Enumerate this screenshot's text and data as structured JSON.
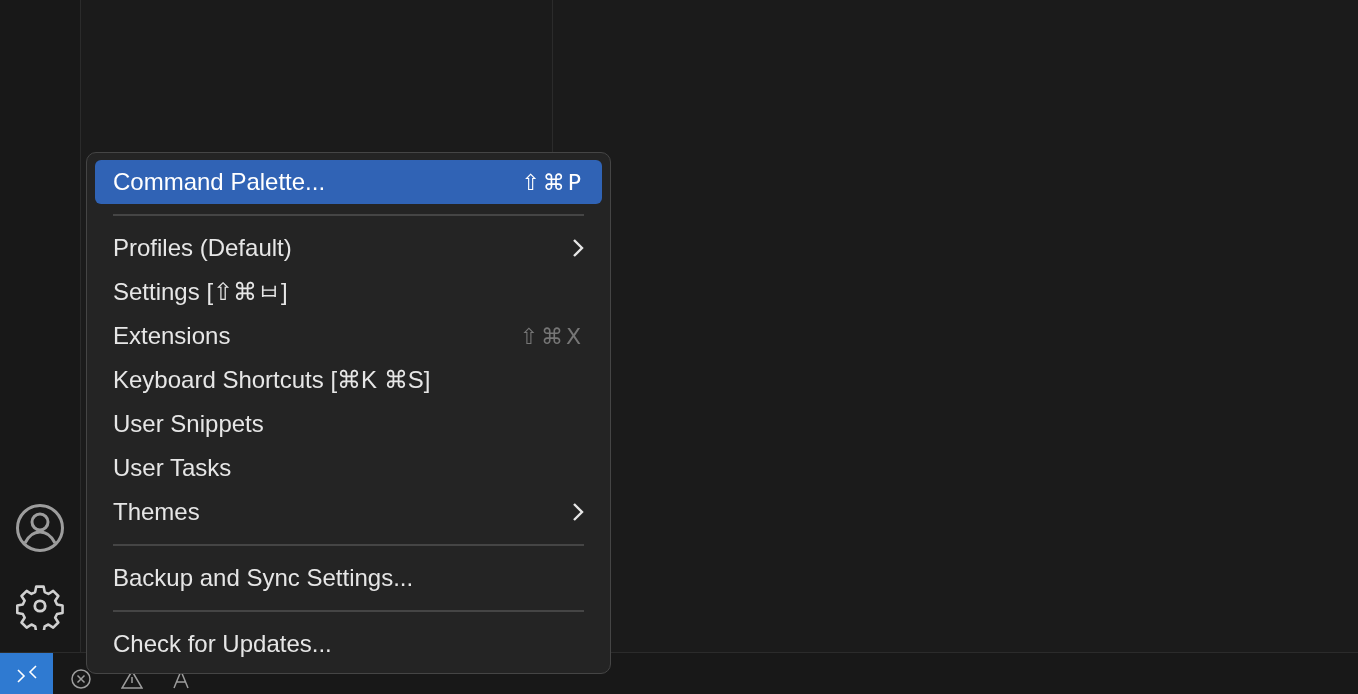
{
  "activity_bar": {
    "items": [
      {
        "kind": "account"
      },
      {
        "kind": "settings"
      }
    ]
  },
  "menu": {
    "items": [
      {
        "kind": "item",
        "label": "Command Palette...",
        "shortcut": "⇧⌘P",
        "selected": true
      },
      {
        "kind": "separator"
      },
      {
        "kind": "item",
        "label": "Profiles (Default)",
        "submenu": true,
        "selected": false
      },
      {
        "kind": "item",
        "label": "Settings [⇧⌘ㅂ]",
        "selected": false
      },
      {
        "kind": "item",
        "label": "Extensions",
        "shortcut": "⇧⌘X",
        "selected": false
      },
      {
        "kind": "item",
        "label": "Keyboard Shortcuts [⌘K ⌘S]",
        "selected": false
      },
      {
        "kind": "item",
        "label": "User Snippets",
        "selected": false
      },
      {
        "kind": "item",
        "label": "User Tasks",
        "selected": false
      },
      {
        "kind": "item",
        "label": "Themes",
        "submenu": true,
        "selected": false
      },
      {
        "kind": "separator"
      },
      {
        "kind": "item",
        "label": "Backup and Sync Settings...",
        "selected": false
      },
      {
        "kind": "separator"
      },
      {
        "kind": "item",
        "label": "Check for Updates...",
        "selected": false
      }
    ]
  },
  "status_bar": {
    "items": [
      {
        "kind": "errors"
      },
      {
        "kind": "warnings"
      },
      {
        "kind": "ports"
      }
    ]
  }
}
